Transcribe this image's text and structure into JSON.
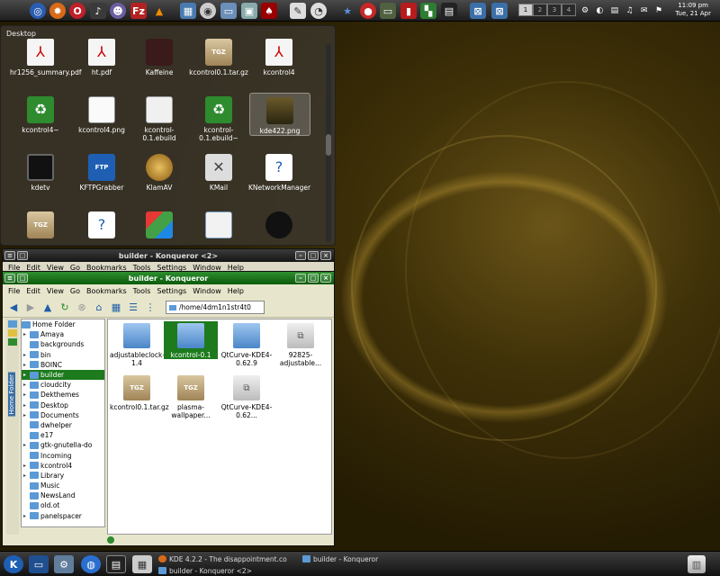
{
  "top_panel": {
    "launchers": [
      "browser-icon",
      "firefox-icon",
      "opera-icon",
      "music-icon",
      "games-icon",
      "filezilla-icon",
      "vlc-icon",
      "folders-icon",
      "media-icon",
      "screens-icon",
      "display-icon",
      "devil-icon",
      "editor-icon",
      "clock-app-icon",
      "star-icon",
      "mail-icon",
      "monitor-icon",
      "software-icon",
      "blocks-icon",
      "terminal-icon",
      "window-icon",
      "window2-icon"
    ],
    "pager": [
      "1",
      "2",
      "3",
      "4"
    ],
    "clock_time": "11:09 pm",
    "clock_date": "Tue, 21 Apr"
  },
  "desktop_view": {
    "title": "Desktop",
    "items": [
      {
        "label": "hr1256_summary.pdf",
        "icon": "pdf-icon"
      },
      {
        "label": "ht.pdf",
        "icon": "pdf-icon"
      },
      {
        "label": "Kaffeine",
        "icon": "kaffeine-icon"
      },
      {
        "label": "kcontrol0.1.tar.gz",
        "icon": "tgz-icon"
      },
      {
        "label": "kcontrol4",
        "icon": "pdf-icon"
      },
      {
        "label": "kcontrol4~",
        "icon": "recycle-icon"
      },
      {
        "label": "kcontrol4.png",
        "icon": "image-icon"
      },
      {
        "label": "kcontrol-0.1.ebuild",
        "icon": "text-file-icon"
      },
      {
        "label": "kcontrol-0.1.ebuild~",
        "icon": "recycle-icon"
      },
      {
        "label": "kde422.png",
        "icon": "image-icon"
      },
      {
        "label": "kdetv",
        "icon": "tv-icon"
      },
      {
        "label": "KFTPGrabber",
        "icon": "kftp-icon"
      },
      {
        "label": "KlamAV",
        "icon": "klamav-icon"
      },
      {
        "label": "KMail",
        "icon": "kmail-icon"
      },
      {
        "label": "KNetworkManager",
        "icon": "unknown-icon"
      },
      {
        "label": "",
        "icon": "tgz-icon"
      },
      {
        "label": "",
        "icon": "unknown-icon"
      },
      {
        "label": "",
        "icon": "blocks-icon"
      },
      {
        "label": "",
        "icon": "document-icon"
      },
      {
        "label": "",
        "icon": "mascot-icon"
      }
    ]
  },
  "back_window": {
    "title": "builder - Konqueror <2>",
    "menu": [
      "File",
      "Edit",
      "View",
      "Go",
      "Bookmarks",
      "Tools",
      "Settings",
      "Window",
      "Help"
    ]
  },
  "front_window": {
    "title": "builder - Konqueror",
    "menu": [
      "File",
      "Edit",
      "View",
      "Go",
      "Bookmarks",
      "Tools",
      "Settings",
      "Window",
      "Help"
    ],
    "location": "/home/4dm1n1str4t0",
    "sidebar_tab": "Home Folder",
    "tree": [
      {
        "label": "Home Folder",
        "root": true
      },
      {
        "label": "Amaya"
      },
      {
        "label": "backgrounds"
      },
      {
        "label": "bin"
      },
      {
        "label": "BOINC"
      },
      {
        "label": "builder",
        "selected": true
      },
      {
        "label": "cloudcity"
      },
      {
        "label": "Dekthemes"
      },
      {
        "label": "Desktop"
      },
      {
        "label": "Documents"
      },
      {
        "label": "dwhelper"
      },
      {
        "label": "e17"
      },
      {
        "label": "gtk-gnutella-do"
      },
      {
        "label": "Incoming"
      },
      {
        "label": "kcontrol4"
      },
      {
        "label": "Library"
      },
      {
        "label": "Music"
      },
      {
        "label": "NewsLand"
      },
      {
        "label": "old.ot"
      },
      {
        "label": "panelspacer"
      }
    ],
    "files": [
      {
        "label": "adjustableclock-1.4",
        "type": "folder"
      },
      {
        "label": "kcontrol-0.1",
        "type": "folder",
        "selected": true
      },
      {
        "label": "QtCurve-KDE4-0.62.9",
        "type": "folder"
      },
      {
        "label": "92825-adjustable...",
        "type": "zip"
      },
      {
        "label": "kcontrol0.1.tar.gz",
        "type": "tgz"
      },
      {
        "label": "plasma-wallpaper...",
        "type": "tgz"
      },
      {
        "label": "QtCurve-KDE4-0.62...",
        "type": "zip"
      }
    ]
  },
  "bottom_panel": {
    "tasks": [
      {
        "label": "KDE 4.2.2 - The disappointment.co"
      },
      {
        "label": "builder - Konqueror"
      },
      {
        "label": "builder - Konqueror <2>"
      }
    ]
  },
  "colors": {
    "accent": "#1d7a1d",
    "folder_blue": "#4a86c8",
    "window_bg": "#e7e6cc"
  }
}
